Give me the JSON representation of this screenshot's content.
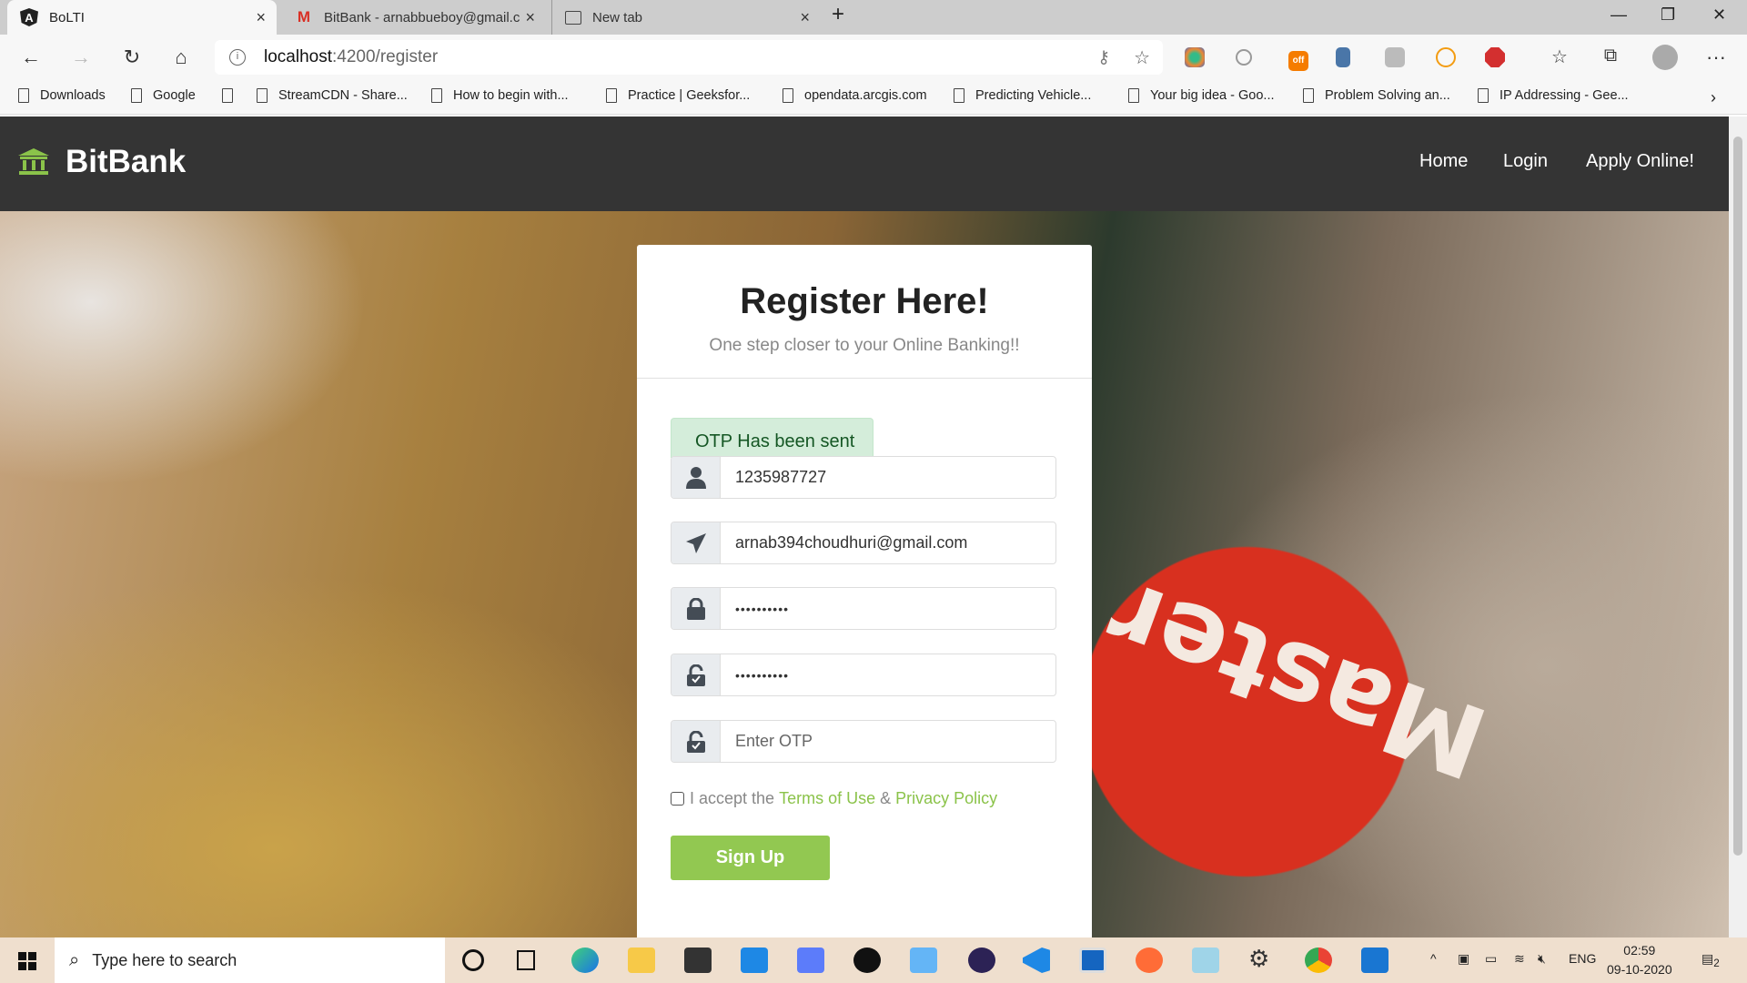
{
  "browser": {
    "tabs": [
      {
        "title": "BoLTI",
        "icon": "angular-icon"
      },
      {
        "title": "BitBank - arnabbueboy@gmail.c",
        "icon": "gmail-icon"
      },
      {
        "title": "New tab",
        "icon": "newtab-icon"
      }
    ],
    "url_host": "localhost",
    "url_path": ":4200/register",
    "bookmarks": [
      "Downloads",
      "Google",
      "",
      "StreamCDN - Share...",
      "How to begin with...",
      "Practice | Geeksfor...",
      "opendata.arcgis.com",
      "Predicting Vehicle...",
      "Your big idea - Goo...",
      "Problem Solving an...",
      "IP Addressing - Gee..."
    ],
    "ext_badge": "off"
  },
  "navbar": {
    "brand": "BitBank",
    "links": [
      "Home",
      "Login",
      "Apply Online!"
    ]
  },
  "form": {
    "title": "Register Here!",
    "subtitle": "One step closer to your Online Banking!!",
    "alert": "OTP Has been sent",
    "phone": "1235987727",
    "email": "arnab394choudhuri@gmail.com",
    "password": "••••••••••",
    "confirm_password": "••••••••••",
    "otp_placeholder": "Enter OTP",
    "terms_prefix": "I accept the",
    "terms_link": "Terms of Use",
    "terms_amp": "&",
    "privacy_link": "Privacy Policy",
    "submit": "Sign Up"
  },
  "background_text": "Master",
  "taskbar": {
    "search_placeholder": "Type here to search",
    "lang": "ENG",
    "time": "02:59",
    "date": "09-10-2020",
    "notifications": "2"
  },
  "colors": {
    "accent": "#92c851",
    "navbar": "#343434",
    "alert_bg": "#d4edda"
  }
}
